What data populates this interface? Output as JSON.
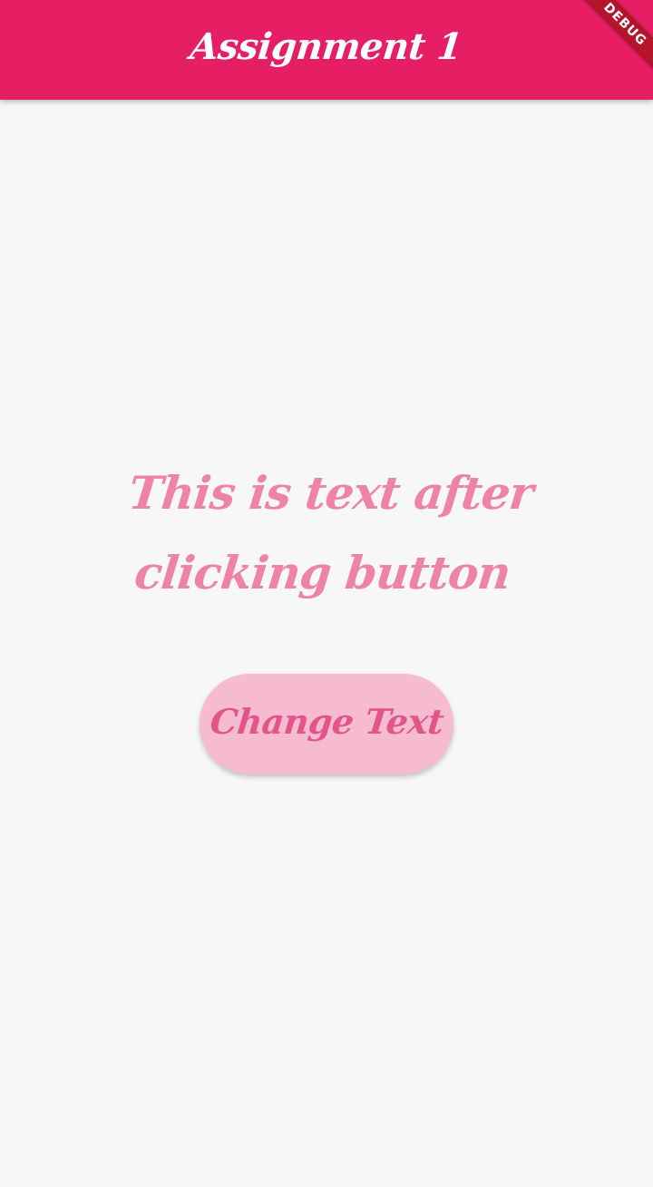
{
  "app_bar": {
    "title": "Assignment 1",
    "color": "#e61e63"
  },
  "debug_banner": {
    "label": "DEBUG"
  },
  "main": {
    "message": "This is text after clicking button",
    "message_color": "#ef82a7",
    "background": "#f7f8f6"
  },
  "button": {
    "label": "Change Text",
    "background": "#f6bbcf",
    "label_color": "#e35489"
  }
}
